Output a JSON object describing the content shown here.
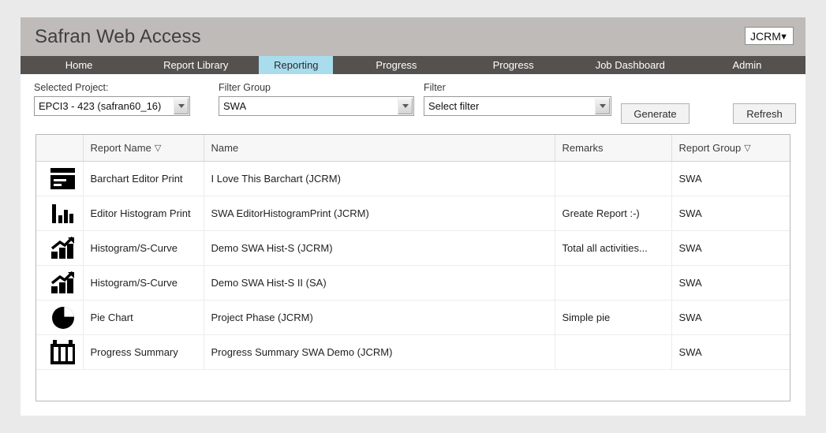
{
  "header": {
    "title": "Safran Web Access",
    "user_select": {
      "value": "JCRM",
      "options": [
        "JCRM"
      ]
    }
  },
  "nav": {
    "items": [
      {
        "label": "Home",
        "active": false
      },
      {
        "label": "Report Library",
        "active": false
      },
      {
        "label": "Reporting",
        "active": true
      },
      {
        "label": "Progress",
        "active": false
      },
      {
        "label": "Progress",
        "active": false
      },
      {
        "label": "Job Dashboard",
        "active": false
      },
      {
        "label": "Admin",
        "active": false
      }
    ]
  },
  "filters": {
    "project": {
      "label": "Selected Project:",
      "value": "EPCI3 - 423 (safran60_16)"
    },
    "group": {
      "label": "Filter Group",
      "value": "SWA"
    },
    "filter": {
      "label": "Filter",
      "value": "Select filter"
    },
    "generate_label": "Generate",
    "refresh_label": "Refresh"
  },
  "table": {
    "columns": [
      {
        "key": "icon",
        "label": "",
        "filterable": false
      },
      {
        "key": "report_name",
        "label": "Report Name",
        "filterable": true
      },
      {
        "key": "name",
        "label": "Name",
        "filterable": false
      },
      {
        "key": "remarks",
        "label": "Remarks",
        "filterable": false
      },
      {
        "key": "report_group",
        "label": "Report Group",
        "filterable": true
      }
    ],
    "rows": [
      {
        "icon": "barchart-editor-icon",
        "report_name": "Barchart Editor Print",
        "name": "I Love This Barchart (JCRM)",
        "remarks": "",
        "report_group": "SWA"
      },
      {
        "icon": "histogram-icon",
        "report_name": "Editor Histogram Print",
        "name": "SWA EditorHistogramPrint (JCRM)",
        "remarks": "Greate Report :-)",
        "report_group": "SWA"
      },
      {
        "icon": "histogram-curve-icon",
        "report_name": "Histogram/S-Curve",
        "name": "Demo SWA Hist-S (JCRM)",
        "remarks": "Total all activities...",
        "report_group": "SWA"
      },
      {
        "icon": "histogram-curve-icon",
        "report_name": "Histogram/S-Curve",
        "name": "Demo SWA Hist-S II (SA)",
        "remarks": "",
        "report_group": "SWA"
      },
      {
        "icon": "pie-chart-icon",
        "report_name": "Pie Chart",
        "name": "Project Phase (JCRM)",
        "remarks": "Simple pie",
        "report_group": "SWA"
      },
      {
        "icon": "progress-summary-icon",
        "report_name": "Progress Summary",
        "name": "Progress Summary SWA Demo (JCRM)",
        "remarks": "",
        "report_group": "SWA"
      }
    ]
  },
  "colors": {
    "page_background": "#eaeaea",
    "titlebar": "#bfbbb8",
    "navbar": "#55514f",
    "active_tab": "#a9dcec",
    "panel": "#ffffff",
    "table_header": "#f7f7f7"
  }
}
